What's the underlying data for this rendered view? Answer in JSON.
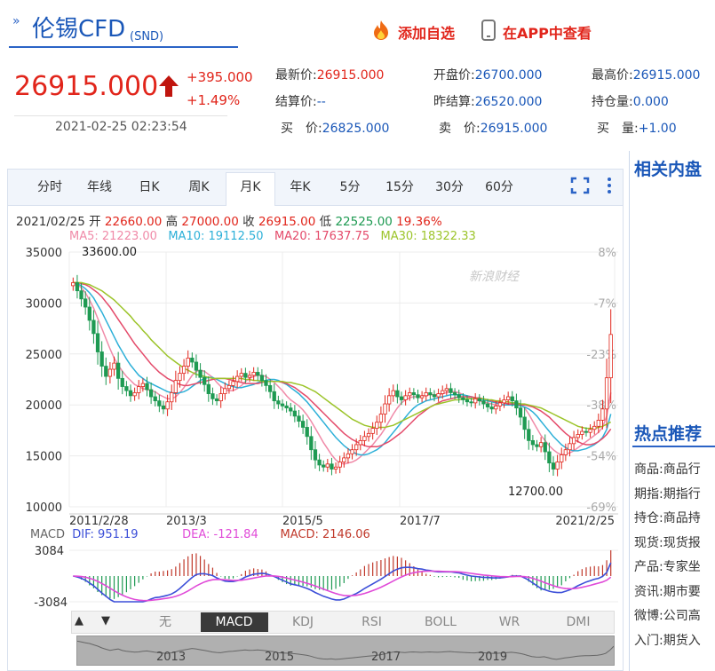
{
  "header": {
    "title": "伦锡CFD",
    "title_sub": "(SND)",
    "add_favorite": "添加自选",
    "view_in_app": "在APP中查看"
  },
  "quote": {
    "price": "26915.000",
    "change": "+395.000",
    "change_pct": "+1.49%",
    "time": "2021-02-25 02:23:54",
    "fields": [
      {
        "label": "最新价:",
        "value": "26915.000",
        "color": "#e1251b"
      },
      {
        "label": "开盘价:",
        "value": "26700.000",
        "color": "#1a57b8"
      },
      {
        "label": "最高价:",
        "value": "26915.000",
        "color": "#1a57b8"
      },
      {
        "label": "结算价:",
        "value": "--",
        "color": "#1a57b8"
      },
      {
        "label": "昨结算:",
        "value": "26520.000",
        "color": "#1a57b8"
      },
      {
        "label": "持仓量:",
        "value": "0.000",
        "color": "#1a57b8"
      },
      {
        "label": "买　价:",
        "value": "26825.000",
        "color": "#1a57b8"
      },
      {
        "label": "卖　价:",
        "value": "26915.000",
        "color": "#1a57b8"
      },
      {
        "label": "买　量:",
        "value": "+1.00",
        "color": "#1a57b8"
      }
    ]
  },
  "tabs": [
    "分时",
    "年线",
    "日K",
    "周K",
    "月K",
    "年K",
    "5分",
    "15分",
    "30分",
    "60分"
  ],
  "active_tab": "月K",
  "ohlc": {
    "date": "2021/02/25",
    "open_label": "开",
    "open": "22660.00",
    "high_label": "高",
    "high": "27000.00",
    "close_label": "收",
    "close": "26915.00",
    "low_label": "低",
    "low": "22525.00",
    "pct": "19.36%"
  },
  "ma": [
    {
      "label": "MA5: 21223.00",
      "color": "#f08aa8"
    },
    {
      "label": "MA10: 19112.50",
      "color": "#2db0d8"
    },
    {
      "label": "MA20: 17637.75",
      "color": "#e44a6a"
    },
    {
      "label": "MA30: 18322.33",
      "color": "#9cc42a"
    }
  ],
  "macd_legend": {
    "title": "MACD",
    "dif": "DIF: 951.19",
    "dea": "DEA: -121.84",
    "macd": "MACD: 2146.06",
    "dif_color": "#3b4ed8",
    "dea_color": "#e04ad8",
    "macd_color": "#c0392b"
  },
  "watermark": "新浪财经",
  "indicators": [
    "无",
    "MACD",
    "KDJ",
    "RSI",
    "BOLL",
    "WR",
    "DMI"
  ],
  "active_indicator": "MACD",
  "navigator_years": [
    "2013",
    "2015",
    "2017",
    "2019"
  ],
  "right_panel": {
    "related_title": "相关内盘",
    "hot_title": "热点推荐",
    "hot_items": [
      {
        "k": "商品:",
        "v": "商品行"
      },
      {
        "k": "期指:",
        "v": "期指行"
      },
      {
        "k": "持仓:",
        "v": "商品持"
      },
      {
        "k": "现货:",
        "v": "现货报"
      },
      {
        "k": "产品:",
        "v": "专家坐"
      },
      {
        "k": "资讯:",
        "v": "期市要"
      },
      {
        "k": "微博:",
        "v": "公司高"
      },
      {
        "k": "入门:",
        "v": "期货入"
      }
    ]
  },
  "chart_data": {
    "type": "candlestick",
    "y_axis_left": [
      "35000",
      "30000",
      "25000",
      "20000",
      "15000",
      "10000"
    ],
    "y_axis_right": [
      "8%",
      "-7%",
      "-23%",
      "-38%",
      "-54%",
      "-69%"
    ],
    "x_axis": [
      "2011/2/28",
      "2013/3",
      "2015/5",
      "2017/7",
      "2021/2/25"
    ],
    "ylim": [
      10000,
      35000
    ],
    "annotations": {
      "high": "33600.00",
      "low": "12700.00"
    },
    "close": [
      32000,
      31200,
      30400,
      29600,
      28300,
      27000,
      25200,
      23800,
      22800,
      23500,
      24100,
      22600,
      21800,
      21400,
      20900,
      21200,
      21800,
      22100,
      21500,
      20800,
      20400,
      19900,
      19600,
      20300,
      21200,
      22400,
      23100,
      23800,
      24600,
      24200,
      23400,
      22700,
      22000,
      21100,
      20600,
      20400,
      21100,
      21600,
      21900,
      22300,
      22800,
      23100,
      22700,
      22900,
      23200,
      22900,
      22400,
      21900,
      21300,
      20400,
      20100,
      19900,
      19700,
      19400,
      18900,
      18400,
      17800,
      16900,
      15600,
      14600,
      14100,
      13900,
      14200,
      13700,
      13900,
      14400,
      14800,
      15200,
      15600,
      16100,
      16500,
      16900,
      17200,
      17700,
      18300,
      19100,
      20100,
      20900,
      21400,
      20800,
      20500,
      20900,
      21200,
      21000,
      20700,
      20900,
      21200,
      21000,
      20800,
      21100,
      21400,
      21600,
      21200,
      21000,
      20700,
      20500,
      20300,
      20200,
      20600,
      20400,
      20100,
      19800,
      19600,
      19900,
      20200,
      20500,
      20800,
      20400,
      19700,
      18800,
      17600,
      16500,
      16100,
      15900,
      16300,
      15400,
      14300,
      13700,
      14400,
      15100,
      15600,
      16200,
      16800,
      17100,
      17400,
      17300,
      17600,
      17900,
      18500,
      19600,
      22660,
      26915
    ],
    "ma5": [
      32000,
      31800,
      31500,
      31000,
      30300,
      29500,
      28500,
      27500,
      26500,
      25500,
      24600,
      23900,
      23300,
      22800,
      22400,
      22000,
      21800,
      21600,
      21500,
      21400,
      21300,
      21000,
      20800,
      20600,
      20600,
      20800,
      21200,
      21700,
      22300,
      22900,
      23300,
      23400,
      23300,
      23000,
      22700,
      22200,
      21800,
      21500,
      21400,
      21400,
      21600,
      21900,
      22300,
      22600,
      22800,
      22900,
      22900,
      22800,
      22500,
      22200,
      21800,
      21400,
      20900,
      20500,
      20200,
      19900,
      19500,
      19000,
      18400,
      17700,
      17000,
      16300,
      15700,
      15100,
      14600,
      14300,
      14200,
      14300,
      14400,
      14600,
      14900,
      15300,
      15700,
      16100,
      16600,
      17100,
      17700,
      18400,
      19100,
      19700,
      20200,
      20500,
      20700,
      20800,
      20800,
      20900,
      20900,
      21000,
      21000,
      21000,
      21100,
      21200,
      21300,
      21300,
      21200,
      21000,
      20800,
      20600,
      20500,
      20400,
      20300,
      20200,
      20100,
      20000,
      20000,
      20000,
      20100,
      20200,
      20200,
      20100,
      19700,
      19100,
      18400,
      17700,
      17000,
      16500,
      16000,
      15600,
      15300,
      15100,
      15200,
      15300,
      15500,
      15800,
      16100,
      16400,
      16700,
      17000,
      17300,
      17800,
      18900,
      21223
    ],
    "ma10": [
      32000,
      31900,
      31700,
      31400,
      31000,
      30500,
      29800,
      29100,
      28300,
      27500,
      26700,
      25900,
      25200,
      24500,
      23900,
      23400,
      22900,
      22600,
      22300,
      22100,
      21900,
      21700,
      21500,
      21300,
      21200,
      21100,
      21200,
      21300,
      21500,
      21800,
      22100,
      22400,
      22600,
      22700,
      22700,
      22500,
      22300,
      22100,
      21900,
      21800,
      21700,
      21700,
      21800,
      21900,
      22000,
      22200,
      22300,
      22400,
      22500,
      22500,
      22400,
      22200,
      22000,
      21700,
      21400,
      21100,
      20700,
      20300,
      19800,
      19300,
      18800,
      18300,
      17800,
      17300,
      16800,
      16400,
      16000,
      15700,
      15400,
      15200,
      15100,
      15100,
      15200,
      15400,
      15600,
      15900,
      16300,
      16800,
      17300,
      17800,
      18300,
      18800,
      19300,
      19700,
      20000,
      20200,
      20400,
      20500,
      20600,
      20700,
      20800,
      20900,
      21000,
      21000,
      21000,
      21000,
      20900,
      20800,
      20700,
      20600,
      20500,
      20400,
      20300,
      20200,
      20100,
      20000,
      20000,
      20000,
      20000,
      19900,
      19800,
      19600,
      19300,
      18900,
      18400,
      17900,
      17400,
      16900,
      16500,
      16100,
      15800,
      15600,
      15500,
      15500,
      15600,
      15700,
      15900,
      16100,
      16400,
      16800,
      17600,
      19112
    ],
    "ma20": [
      32000,
      32000,
      31900,
      31800,
      31600,
      31300,
      31000,
      30600,
      30100,
      29600,
      29000,
      28400,
      27800,
      27200,
      26600,
      26000,
      25500,
      25000,
      24500,
      24000,
      23600,
      23200,
      22900,
      22600,
      22400,
      22200,
      22000,
      21900,
      21900,
      22000,
      22100,
      22200,
      22300,
      22400,
      22500,
      22600,
      22600,
      22600,
      22500,
      22400,
      22300,
      22200,
      22100,
      22100,
      22100,
      22100,
      22200,
      22300,
      22300,
      22300,
      22300,
      22200,
      22100,
      21900,
      21700,
      21400,
      21100,
      20800,
      20400,
      20000,
      19600,
      19200,
      18800,
      18400,
      18000,
      17600,
      17200,
      16900,
      16600,
      16400,
      16200,
      16000,
      15900,
      15900,
      15900,
      16000,
      16200,
      16400,
      16700,
      17000,
      17300,
      17700,
      18100,
      18500,
      18900,
      19200,
      19500,
      19800,
      20000,
      20200,
      20400,
      20500,
      20600,
      20700,
      20800,
      20800,
      20800,
      20800,
      20700,
      20700,
      20600,
      20500,
      20400,
      20300,
      20300,
      20200,
      20100,
      20100,
      20100,
      20000,
      20000,
      19900,
      19800,
      19600,
      19400,
      19100,
      18800,
      18400,
      18000,
      17600,
      17200,
      16900,
      16600,
      16400,
      16200,
      16100,
      16100,
      16200,
      16400,
      16700,
      17100,
      17637
    ],
    "ma30": [
      32000,
      32000,
      32000,
      31900,
      31800,
      31600,
      31400,
      31200,
      30900,
      30600,
      30300,
      29900,
      29500,
      29100,
      28700,
      28200,
      27800,
      27300,
      26900,
      26400,
      26000,
      25600,
      25200,
      24800,
      24500,
      24200,
      23900,
      23600,
      23400,
      23200,
      23000,
      22900,
      22800,
      22700,
      22600,
      22600,
      22600,
      22600,
      22600,
      22600,
      22600,
      22600,
      22500,
      22500,
      22400,
      22400,
      22300,
      22300,
      22300,
      22300,
      22300,
      22300,
      22200,
      22200,
      22100,
      22000,
      21900,
      21700,
      21500,
      21300,
      21000,
      20700,
      20400,
      20100,
      19800,
      19500,
      19200,
      18900,
      18600,
      18400,
      18200,
      18000,
      17900,
      17800,
      17800,
      17800,
      17800,
      17900,
      18000,
      18200,
      18400,
      18600,
      18800,
      19000,
      19200,
      19400,
      19600,
      19800,
      20000,
      20100,
      20200,
      20300,
      20400,
      20500,
      20500,
      20600,
      20600,
      20600,
      20600,
      20600,
      20600,
      20500,
      20500,
      20400,
      20400,
      20300,
      20300,
      20200,
      20200,
      20100,
      20100,
      20000,
      19900,
      19800,
      19700,
      19500,
      19300,
      19100,
      18900,
      18700,
      18500,
      18300,
      18100,
      17900,
      17800,
      17700,
      17700,
      17700,
      17800,
      17900,
      18100,
      18322
    ],
    "macd_ylim": [
      -3084,
      3084
    ],
    "macd_axis": [
      "3084",
      "-3084"
    ]
  }
}
